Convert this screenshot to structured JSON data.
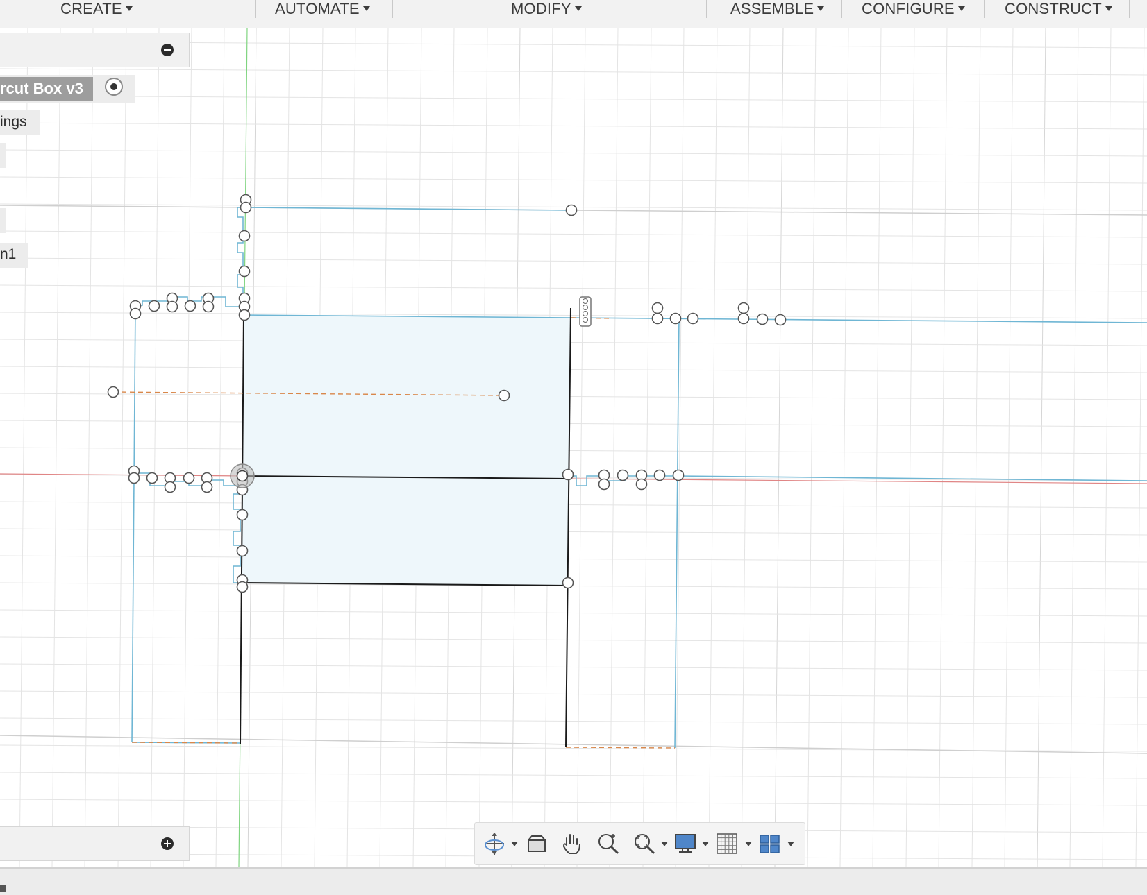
{
  "toolbar": {
    "create": "CREATE",
    "automate": "AUTOMATE",
    "modify": "MODIFY",
    "assemble": "ASSEMBLE",
    "configure": "CONFIGURE",
    "construct": "CONSTRUCT"
  },
  "browser": {
    "document_name": "rcut Box v3",
    "items": [
      "ings",
      "n1"
    ]
  },
  "colors": {
    "sketch_line": "#6fb6d4",
    "fully_constrained": "#1a1a1a",
    "profile_fill": "#eef7fb",
    "construction": "#d9874a",
    "x_axis": "#e08585",
    "y_axis": "#7fd47f",
    "grid": "#e4e4e4"
  },
  "navbar": {
    "icons": [
      "orbit-icon",
      "look-at-icon",
      "pan-icon",
      "zoom-icon",
      "fit-icon",
      "display-settings-icon",
      "grid-snap-icon",
      "viewports-icon"
    ]
  }
}
